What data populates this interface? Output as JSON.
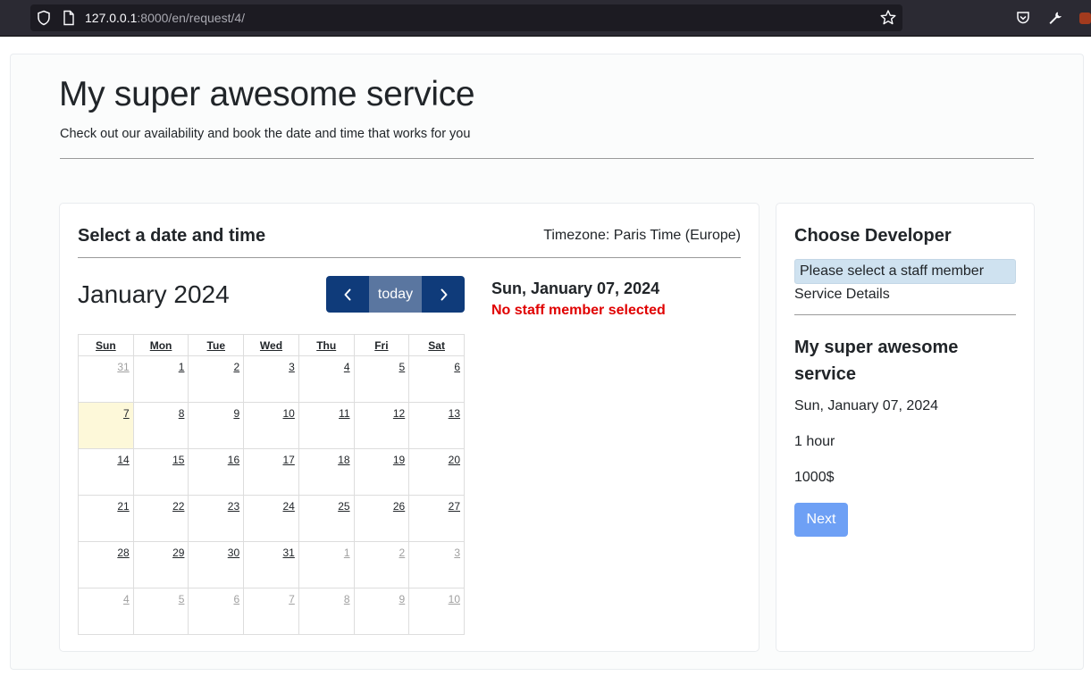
{
  "browser": {
    "url_host": "127.0.0.1",
    "url_rest": ":8000/en/request/4/"
  },
  "header": {
    "title": "My super awesome service",
    "subtitle": "Check out our availability and book the date and time that works for you"
  },
  "booking": {
    "heading": "Select a date and time",
    "timezone": "Timezone: Paris Time (Europe)",
    "month_title": "January 2024",
    "today_label": "today",
    "selected_date": "Sun, January 07, 2024",
    "staff_warning": "No staff member selected"
  },
  "calendar": {
    "weekdays": [
      "Sun",
      "Mon",
      "Tue",
      "Wed",
      "Thu",
      "Fri",
      "Sat"
    ],
    "weeks": [
      [
        "31",
        "1",
        "2",
        "3",
        "4",
        "5",
        "6"
      ],
      [
        "7",
        "8",
        "9",
        "10",
        "11",
        "12",
        "13"
      ],
      [
        "14",
        "15",
        "16",
        "17",
        "18",
        "19",
        "20"
      ],
      [
        "21",
        "22",
        "23",
        "24",
        "25",
        "26",
        "27"
      ],
      [
        "28",
        "29",
        "30",
        "31",
        "1",
        "2",
        "3"
      ],
      [
        "4",
        "5",
        "6",
        "7",
        "8",
        "9",
        "10"
      ]
    ]
  },
  "sidebar": {
    "heading": "Choose Developer",
    "staff_placeholder": "Please select a staff member",
    "service_details_label": "Service Details",
    "service_name": "My super awesome service",
    "date": "Sun, January 07, 2024",
    "duration": "1 hour",
    "price": "1000$",
    "next_label": "Next"
  },
  "colors": {
    "nav_button": "#0f3b7a",
    "today_button": "#5a76a0",
    "warning": "#e00000",
    "next_button": "#6ea0f5",
    "today_highlight": "#fdf8d9"
  }
}
